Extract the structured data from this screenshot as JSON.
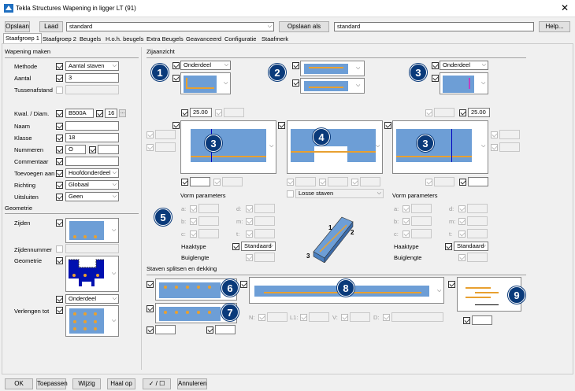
{
  "window": {
    "title": "Tekla Structures  Wapening in ligger LT (91)",
    "close": "✕"
  },
  "toolbar": {
    "save": "Opslaan",
    "load": "Laad",
    "load_value": "standard",
    "save_as": "Opslaan als",
    "save_as_value": "standard",
    "help": "Help..."
  },
  "tabs": [
    "Staafgroep 1",
    "Staafgroep 2",
    "Beugels",
    "H.o.h. beugels",
    "Extra Beugels",
    "Geavanceerd",
    "Configuratie",
    "Staafmerk"
  ],
  "left": {
    "section1": "Wapening maken",
    "methode_label": "Methode",
    "methode_value": "Aantal staven",
    "aantal_label": "Aantal",
    "aantal_value": "3",
    "tussen_label": "Tussenafstand",
    "kwal_label": "Kwal. / Diam.",
    "kwal_value": "B500A",
    "diam_value": "16",
    "dots": "...",
    "naam_label": "Naam",
    "klasse_label": "Klasse",
    "klasse_value": "18",
    "nummeren_label": "Nummeren",
    "nummeren_value": "O",
    "commentaar_label": "Commentaar",
    "toevoegen_label": "Toevoegen aan",
    "toevoegen_value": "Hoofdonderdeel",
    "richting_label": "Richting",
    "richting_value": "Globaal",
    "uitsluiten_label": "Uitsluiten",
    "uitsluiten_value": "Geen",
    "section2": "Geometrie",
    "zijden_label": "Zijden",
    "zijdennummer_label": "Zijdennummer",
    "geometrie_label": "Geometrie",
    "onderdeel_value": "Onderdeel",
    "verlengen_label": "Verlengen tot"
  },
  "main": {
    "zijaanzicht": "Zijaanzicht",
    "onderdeel1": "Onderdeel",
    "onderdeel3": "Onderdeel",
    "val_left": "25.00",
    "val_right": "25.00",
    "badges": [
      "1",
      "2",
      "3",
      "3",
      "4",
      "3",
      "5",
      "6",
      "7",
      "8",
      "9"
    ],
    "vorm_left": "Vorm parameters",
    "vorm_right": "Vorm parameters",
    "losse": "Losse staven",
    "params_a": "a:",
    "params_b": "b:",
    "params_c": "c:",
    "params_d": "d:",
    "params_m": "m:",
    "params_t": "t:",
    "haaktype": "Haaktype",
    "haak_value": "Standaard",
    "buig": "Buiglengte",
    "iso_labels": [
      "1",
      "2",
      "3"
    ],
    "splitsen": "Staven splitsen en dekking",
    "n": "N:",
    "l1": "L1:",
    "v": "V:",
    "d": "D:"
  },
  "bottom": {
    "ok": "OK",
    "apply": "Toepassen",
    "modify": "Wijzig",
    "get": "Haal op",
    "toggle": "✓ / ☐",
    "cancel": "Annuleren"
  }
}
